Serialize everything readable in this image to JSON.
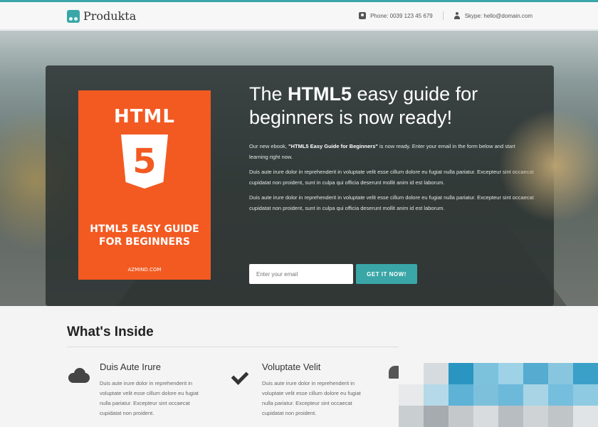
{
  "header": {
    "logo_text": "Produkta",
    "phone_label": "Phone: 0039 123 45 679",
    "skype_label": "Skype: hello@domain.com"
  },
  "hero": {
    "headline_pre": "The ",
    "headline_bold": "HTML5",
    "headline_post": " easy guide for beginners is now ready!",
    "intro_pre": "Our new ebook, ",
    "intro_bold": "\"HTML5 Easy Guide for Beginners\"",
    "intro_post": " is now ready. Enter your email in the form below and start learning right now.",
    "para2": "Duis aute irure dolor in reprehenderit in voluptate velit esse cillum dolore eu fugiat nulla pariatur. Excepteur sint occaecat cupidatat non proident, sunt in culpa qui officia deserunt mollit anim id est laborum.",
    "para3": "Duis aute irure dolor in reprehenderit in voluptate velit esse cillum dolore eu fugiat nulla pariatur. Excepteur sint occaecat cupidatat non proident, sunt in culpa qui officia deserunt mollit anim id est laborum.",
    "email_placeholder": "Enter your email",
    "cta_label": "GET IT NOW!"
  },
  "book": {
    "title_top": "HTML",
    "number": "5",
    "title_line1": "HTML5 EASY GUIDE",
    "title_line2": "FOR BEGINNERS",
    "publisher": "AZMIND.COM"
  },
  "inside": {
    "title": "What's Inside",
    "features": [
      {
        "title": "Duis Aute Irure",
        "text": "Duis aute irure dolor in reprehenderit in voluptate velit esse cillum dolore eu fugiat nulla pariatur. Excepteur sint occaecat cupidatat non proident."
      },
      {
        "title": "Voluptate Velit",
        "text": "Duis aute irure dolor in reprehenderit in voluptate velit esse cillum dolore eu fugiat nulla pariatur. Excepteur sint occaecat cupidatat non proident."
      }
    ]
  },
  "colors": {
    "accent": "#3aa6a7",
    "book_orange": "#f25a22",
    "panel": "#2c3432"
  },
  "icons": [
    "phone-icon",
    "user-icon",
    "cloud-icon",
    "check-icon",
    "twitter-icon"
  ]
}
